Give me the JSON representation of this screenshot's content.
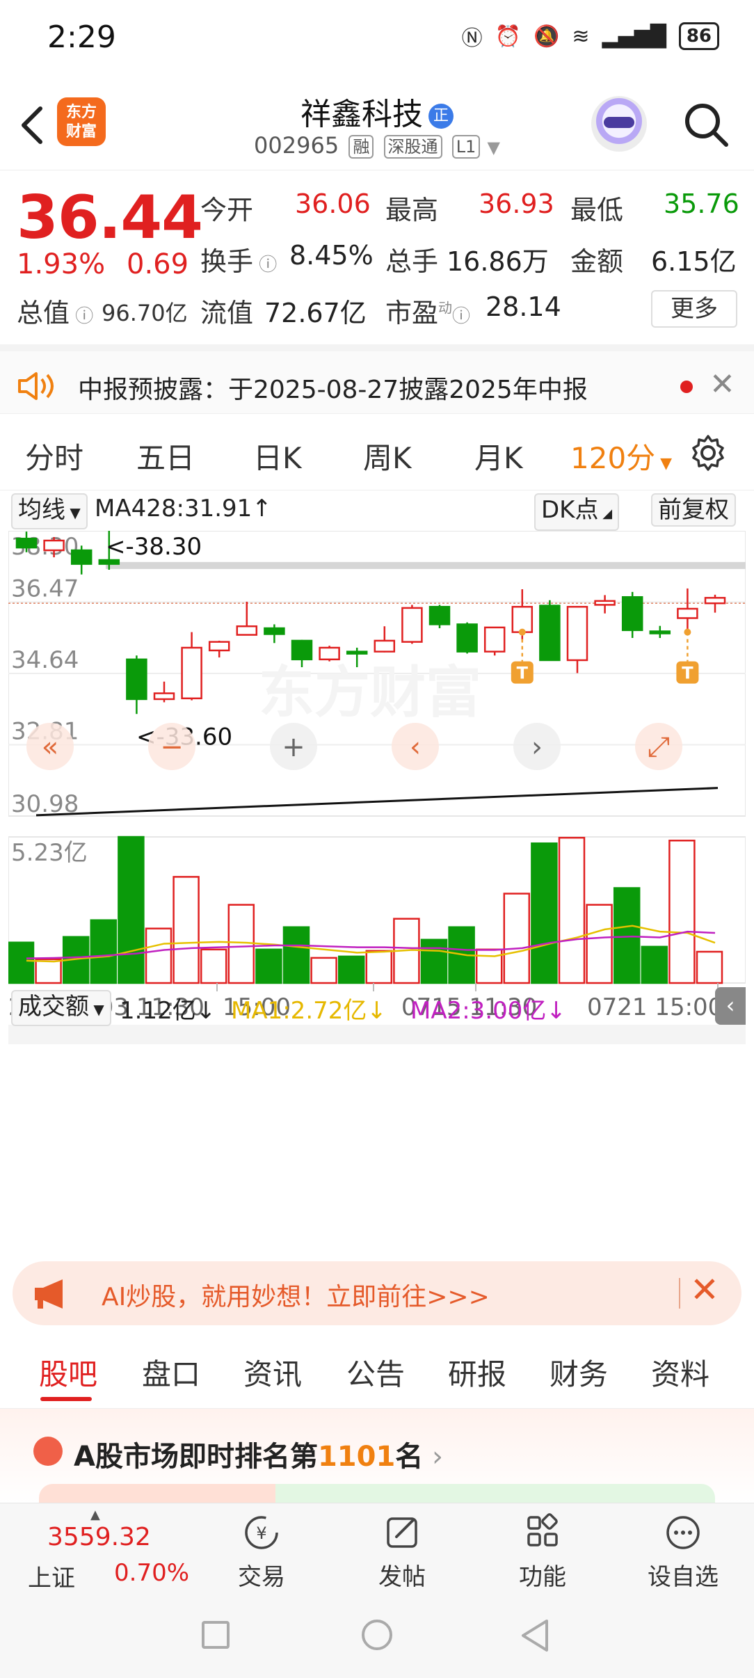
{
  "status": {
    "time": "2:29",
    "battery": "86"
  },
  "header": {
    "logo_line1": "东方",
    "logo_line2": "财富",
    "stock_name": "祥鑫科技",
    "name_badge": "正",
    "code": "002965",
    "tags": [
      "融",
      "深股通",
      "L1"
    ]
  },
  "quote": {
    "price": "36.44",
    "change_pct": "1.93%",
    "change": "0.69",
    "open_label": "今开",
    "open": "36.06",
    "high_label": "最高",
    "high": "36.93",
    "low_label": "最低",
    "low": "35.76",
    "turnover_label": "换手",
    "turnover": "8.45%",
    "volume_label": "总手",
    "volume": "16.86万",
    "amount_label": "金额",
    "amount": "6.15亿",
    "mktcap_label": "总值",
    "mktcap": "96.70亿",
    "float_label": "流值",
    "float": "72.67亿",
    "pe_label": "市盈",
    "pe_sup": "动",
    "pe": "28.14",
    "more_label": "更多"
  },
  "notice": {
    "text": "中报预披露：于2025-08-27披露2025年中报"
  },
  "period_tabs": [
    "分时",
    "五日",
    "日K",
    "周K",
    "月K",
    "120分"
  ],
  "chart_controls": {
    "ma_select": "均线",
    "ma_value": "MA428:31.91↑",
    "dk_label": "DK点",
    "adjust_label": "前复权",
    "vol_select": "成交额",
    "vol_value": "1.12亿↓",
    "ma1_value": "MA1:2.72亿↓",
    "ma2_value": "MA2:3.00亿↓",
    "vol_axis_max": "5.23亿",
    "high_marker": "<-38.30",
    "low_marker": "<-33.60",
    "t_marker": "T",
    "watermark": "东方财富"
  },
  "chart_data": {
    "type": "candlestick",
    "y_ticks": [
      "38.30",
      "36.47",
      "34.64",
      "32.81",
      "30.98"
    ],
    "ylim": [
      30.98,
      38.3
    ],
    "x_ticks": [
      "20250703 11:30",
      "15:00",
      "0715 11:30",
      "0721 15:00"
    ],
    "last_price": 36.44,
    "candles": [
      {
        "o": 37.87,
        "c": 38.1,
        "h": 38.28,
        "l": 37.75,
        "dir": "down"
      },
      {
        "o": 37.8,
        "c": 38.05,
        "h": 38.14,
        "l": 37.62,
        "dir": "up"
      },
      {
        "o": 37.8,
        "c": 37.45,
        "h": 37.92,
        "l": 37.18,
        "dir": "down"
      },
      {
        "o": 37.55,
        "c": 37.45,
        "h": 38.3,
        "l": 37.3,
        "dir": "down"
      },
      {
        "o": 35.0,
        "c": 33.98,
        "h": 35.1,
        "l": 33.6,
        "dir": "down"
      },
      {
        "o": 33.98,
        "c": 34.13,
        "h": 34.43,
        "l": 33.9,
        "dir": "up"
      },
      {
        "o": 34.0,
        "c": 35.3,
        "h": 35.7,
        "l": 33.95,
        "dir": "up"
      },
      {
        "o": 35.23,
        "c": 35.45,
        "h": 35.48,
        "l": 35.05,
        "dir": "up"
      },
      {
        "o": 35.63,
        "c": 35.85,
        "h": 36.48,
        "l": 35.62,
        "dir": "up"
      },
      {
        "o": 35.8,
        "c": 35.65,
        "h": 35.9,
        "l": 35.42,
        "dir": "down"
      },
      {
        "o": 35.48,
        "c": 35.0,
        "h": 35.5,
        "l": 34.8,
        "dir": "down"
      },
      {
        "o": 35.0,
        "c": 35.3,
        "h": 35.35,
        "l": 34.95,
        "dir": "up"
      },
      {
        "o": 35.2,
        "c": 35.15,
        "h": 35.3,
        "l": 34.8,
        "dir": "down"
      },
      {
        "o": 35.2,
        "c": 35.48,
        "h": 35.85,
        "l": 35.18,
        "dir": "up"
      },
      {
        "o": 35.45,
        "c": 36.32,
        "h": 36.4,
        "l": 35.4,
        "dir": "up"
      },
      {
        "o": 36.35,
        "c": 35.9,
        "h": 36.4,
        "l": 35.8,
        "dir": "down"
      },
      {
        "o": 35.9,
        "c": 35.2,
        "h": 35.95,
        "l": 35.15,
        "dir": "down"
      },
      {
        "o": 35.2,
        "c": 35.82,
        "h": 35.82,
        "l": 35.1,
        "dir": "up"
      },
      {
        "o": 35.7,
        "c": 36.35,
        "h": 36.8,
        "l": 35.48,
        "dir": "up"
      },
      {
        "o": 36.38,
        "c": 34.98,
        "h": 36.52,
        "l": 34.98,
        "dir": "down"
      },
      {
        "o": 34.98,
        "c": 36.35,
        "h": 36.35,
        "l": 34.65,
        "dir": "up"
      },
      {
        "o": 36.4,
        "c": 36.5,
        "h": 36.65,
        "l": 36.18,
        "dir": "up"
      },
      {
        "o": 36.6,
        "c": 35.75,
        "h": 36.73,
        "l": 35.55,
        "dir": "down"
      },
      {
        "o": 35.72,
        "c": 35.72,
        "h": 35.86,
        "l": 35.55,
        "dir": "down"
      },
      {
        "o": 36.06,
        "c": 36.3,
        "h": 36.82,
        "l": 35.76,
        "dir": "up"
      },
      {
        "o": 36.44,
        "c": 36.58,
        "h": 36.66,
        "l": 36.2,
        "dir": "up"
      }
    ],
    "volume_bars": [
      {
        "v": 1.45,
        "dir": "down"
      },
      {
        "v": 0.85,
        "dir": "up"
      },
      {
        "v": 1.65,
        "dir": "down"
      },
      {
        "v": 2.25,
        "dir": "down"
      },
      {
        "v": 5.23,
        "dir": "down"
      },
      {
        "v": 1.95,
        "dir": "up"
      },
      {
        "v": 3.8,
        "dir": "up"
      },
      {
        "v": 1.2,
        "dir": "up"
      },
      {
        "v": 2.8,
        "dir": "up"
      },
      {
        "v": 1.2,
        "dir": "down"
      },
      {
        "v": 2.0,
        "dir": "down"
      },
      {
        "v": 0.9,
        "dir": "up"
      },
      {
        "v": 0.95,
        "dir": "down"
      },
      {
        "v": 1.15,
        "dir": "up"
      },
      {
        "v": 2.3,
        "dir": "up"
      },
      {
        "v": 1.55,
        "dir": "down"
      },
      {
        "v": 2.0,
        "dir": "down"
      },
      {
        "v": 1.2,
        "dir": "up"
      },
      {
        "v": 3.2,
        "dir": "up"
      },
      {
        "v": 5.0,
        "dir": "down"
      },
      {
        "v": 5.2,
        "dir": "up"
      },
      {
        "v": 2.8,
        "dir": "up"
      },
      {
        "v": 3.4,
        "dir": "down"
      },
      {
        "v": 1.3,
        "dir": "down"
      },
      {
        "v": 5.1,
        "dir": "up"
      },
      {
        "v": 1.12,
        "dir": "up"
      }
    ],
    "ma1": [
      0.5,
      0.48,
      0.55,
      0.6,
      0.74,
      0.88,
      0.9,
      0.92,
      0.9,
      0.86,
      0.8,
      0.74,
      0.68,
      0.7,
      0.74,
      0.72,
      0.62,
      0.6,
      0.72,
      0.88,
      1.02,
      1.2,
      1.28,
      1.15,
      1.12,
      0.9
    ],
    "ma2": [
      0.55,
      0.56,
      0.58,
      0.62,
      0.66,
      0.74,
      0.78,
      0.8,
      0.82,
      0.84,
      0.84,
      0.82,
      0.8,
      0.8,
      0.78,
      0.78,
      0.74,
      0.74,
      0.78,
      0.9,
      0.98,
      1.02,
      1.04,
      1.02,
      1.15,
      1.12
    ],
    "ma_scale_max": 5.23
  },
  "ai_banner": {
    "text": "AI炒股，就用妙想！立即前往>>>"
  },
  "content_tabs": [
    "股吧",
    "盘口",
    "资讯",
    "公告",
    "研报",
    "财务",
    "资料"
  ],
  "rank": {
    "prefix": "A股市场即时排名第",
    "number": "1101",
    "suffix": "名"
  },
  "bottombar": {
    "index_value": "3559.32",
    "index_name": "上证",
    "index_pct": "0.70%",
    "trade": "交易",
    "post": "发帖",
    "func": "功能",
    "watch": "设自选"
  },
  "colors": {
    "up": "#e02020",
    "down": "#0a9a0a",
    "accent": "#f08010"
  }
}
